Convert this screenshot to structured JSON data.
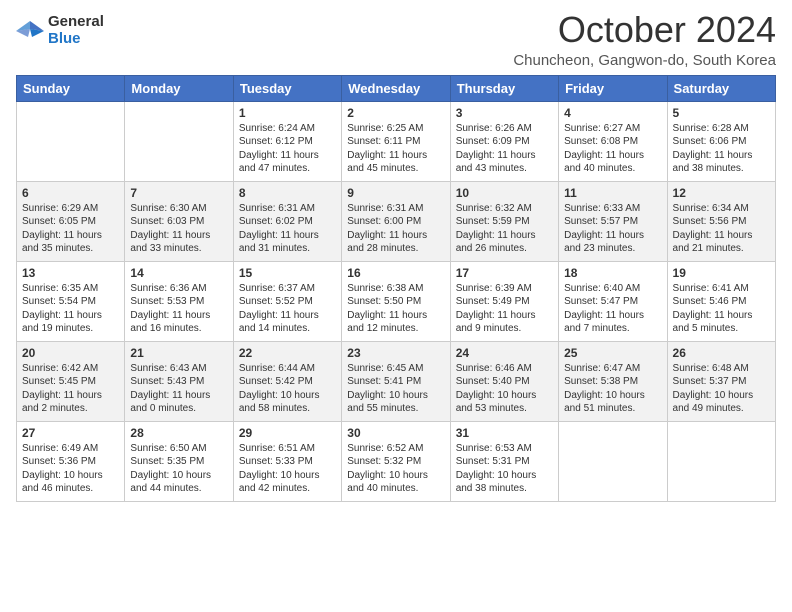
{
  "header": {
    "logo": {
      "general": "General",
      "blue": "Blue"
    },
    "title": "October 2024",
    "location": "Chuncheon, Gangwon-do, South Korea"
  },
  "days_of_week": [
    "Sunday",
    "Monday",
    "Tuesday",
    "Wednesday",
    "Thursday",
    "Friday",
    "Saturday"
  ],
  "weeks": [
    [
      {
        "day": "",
        "info": ""
      },
      {
        "day": "",
        "info": ""
      },
      {
        "day": "1",
        "info": "Sunrise: 6:24 AM\nSunset: 6:12 PM\nDaylight: 11 hours and 47 minutes."
      },
      {
        "day": "2",
        "info": "Sunrise: 6:25 AM\nSunset: 6:11 PM\nDaylight: 11 hours and 45 minutes."
      },
      {
        "day": "3",
        "info": "Sunrise: 6:26 AM\nSunset: 6:09 PM\nDaylight: 11 hours and 43 minutes."
      },
      {
        "day": "4",
        "info": "Sunrise: 6:27 AM\nSunset: 6:08 PM\nDaylight: 11 hours and 40 minutes."
      },
      {
        "day": "5",
        "info": "Sunrise: 6:28 AM\nSunset: 6:06 PM\nDaylight: 11 hours and 38 minutes."
      }
    ],
    [
      {
        "day": "6",
        "info": "Sunrise: 6:29 AM\nSunset: 6:05 PM\nDaylight: 11 hours and 35 minutes."
      },
      {
        "day": "7",
        "info": "Sunrise: 6:30 AM\nSunset: 6:03 PM\nDaylight: 11 hours and 33 minutes."
      },
      {
        "day": "8",
        "info": "Sunrise: 6:31 AM\nSunset: 6:02 PM\nDaylight: 11 hours and 31 minutes."
      },
      {
        "day": "9",
        "info": "Sunrise: 6:31 AM\nSunset: 6:00 PM\nDaylight: 11 hours and 28 minutes."
      },
      {
        "day": "10",
        "info": "Sunrise: 6:32 AM\nSunset: 5:59 PM\nDaylight: 11 hours and 26 minutes."
      },
      {
        "day": "11",
        "info": "Sunrise: 6:33 AM\nSunset: 5:57 PM\nDaylight: 11 hours and 23 minutes."
      },
      {
        "day": "12",
        "info": "Sunrise: 6:34 AM\nSunset: 5:56 PM\nDaylight: 11 hours and 21 minutes."
      }
    ],
    [
      {
        "day": "13",
        "info": "Sunrise: 6:35 AM\nSunset: 5:54 PM\nDaylight: 11 hours and 19 minutes."
      },
      {
        "day": "14",
        "info": "Sunrise: 6:36 AM\nSunset: 5:53 PM\nDaylight: 11 hours and 16 minutes."
      },
      {
        "day": "15",
        "info": "Sunrise: 6:37 AM\nSunset: 5:52 PM\nDaylight: 11 hours and 14 minutes."
      },
      {
        "day": "16",
        "info": "Sunrise: 6:38 AM\nSunset: 5:50 PM\nDaylight: 11 hours and 12 minutes."
      },
      {
        "day": "17",
        "info": "Sunrise: 6:39 AM\nSunset: 5:49 PM\nDaylight: 11 hours and 9 minutes."
      },
      {
        "day": "18",
        "info": "Sunrise: 6:40 AM\nSunset: 5:47 PM\nDaylight: 11 hours and 7 minutes."
      },
      {
        "day": "19",
        "info": "Sunrise: 6:41 AM\nSunset: 5:46 PM\nDaylight: 11 hours and 5 minutes."
      }
    ],
    [
      {
        "day": "20",
        "info": "Sunrise: 6:42 AM\nSunset: 5:45 PM\nDaylight: 11 hours and 2 minutes."
      },
      {
        "day": "21",
        "info": "Sunrise: 6:43 AM\nSunset: 5:43 PM\nDaylight: 11 hours and 0 minutes."
      },
      {
        "day": "22",
        "info": "Sunrise: 6:44 AM\nSunset: 5:42 PM\nDaylight: 10 hours and 58 minutes."
      },
      {
        "day": "23",
        "info": "Sunrise: 6:45 AM\nSunset: 5:41 PM\nDaylight: 10 hours and 55 minutes."
      },
      {
        "day": "24",
        "info": "Sunrise: 6:46 AM\nSunset: 5:40 PM\nDaylight: 10 hours and 53 minutes."
      },
      {
        "day": "25",
        "info": "Sunrise: 6:47 AM\nSunset: 5:38 PM\nDaylight: 10 hours and 51 minutes."
      },
      {
        "day": "26",
        "info": "Sunrise: 6:48 AM\nSunset: 5:37 PM\nDaylight: 10 hours and 49 minutes."
      }
    ],
    [
      {
        "day": "27",
        "info": "Sunrise: 6:49 AM\nSunset: 5:36 PM\nDaylight: 10 hours and 46 minutes."
      },
      {
        "day": "28",
        "info": "Sunrise: 6:50 AM\nSunset: 5:35 PM\nDaylight: 10 hours and 44 minutes."
      },
      {
        "day": "29",
        "info": "Sunrise: 6:51 AM\nSunset: 5:33 PM\nDaylight: 10 hours and 42 minutes."
      },
      {
        "day": "30",
        "info": "Sunrise: 6:52 AM\nSunset: 5:32 PM\nDaylight: 10 hours and 40 minutes."
      },
      {
        "day": "31",
        "info": "Sunrise: 6:53 AM\nSunset: 5:31 PM\nDaylight: 10 hours and 38 minutes."
      },
      {
        "day": "",
        "info": ""
      },
      {
        "day": "",
        "info": ""
      }
    ]
  ]
}
